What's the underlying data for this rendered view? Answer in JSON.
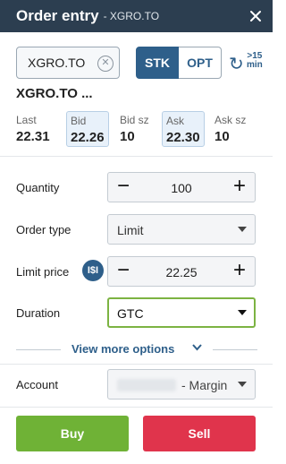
{
  "header": {
    "title": "Order entry",
    "subtitle": "- XGRO.TO",
    "close_icon": "close-icon"
  },
  "instrument": {
    "symbol_value": "XGRO.TO",
    "clear_icon": "clear-icon",
    "stk_label": "STK",
    "opt_label": "OPT",
    "refresh_icon": "refresh-icon",
    "refresh_label_line1": ">15",
    "refresh_label_line2": "min",
    "name": "XGRO.TO ..."
  },
  "quotes": [
    {
      "label": "Last",
      "value": "22.31"
    },
    {
      "label": "Bid",
      "value": "22.26"
    },
    {
      "label": "Bid sz",
      "value": "10"
    },
    {
      "label": "Ask",
      "value": "22.30"
    },
    {
      "label": "Ask sz",
      "value": "10"
    }
  ],
  "form": {
    "quantity_label": "Quantity",
    "quantity_value": "100",
    "order_type_label": "Order type",
    "order_type_value": "Limit",
    "limit_price_label": "Limit price",
    "currency_icon_text": "I$I",
    "limit_price_value": "22.25",
    "duration_label": "Duration",
    "duration_value": "GTC",
    "more_options": "View more options",
    "account_label": "Account",
    "account_value": "- Margin"
  },
  "actions": {
    "buy_label": "Buy",
    "sell_label": "Sell"
  },
  "colors": {
    "header_bg": "#2c3e50",
    "accent": "#2e5f8a",
    "buy": "#6fb236",
    "sell": "#e0344c",
    "focus": "#7cb342"
  }
}
